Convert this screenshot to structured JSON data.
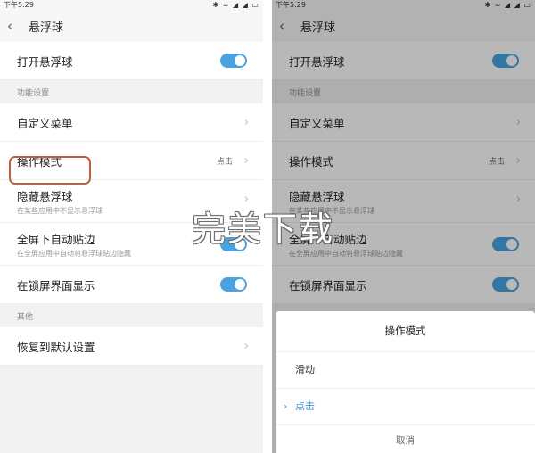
{
  "status_bar": {
    "time": "下午5:29",
    "icons": "✱ ≈ ◢ ◢ ▭"
  },
  "title": "悬浮球",
  "rows": {
    "open_float": "打开悬浮球",
    "section_function": "功能设置",
    "custom_menu": "自定义菜单",
    "operation_mode": "操作模式",
    "operation_mode_value": "点击",
    "hide_float": "隐藏悬浮球",
    "hide_float_sub": "在某些应用中不显示悬浮球",
    "fullscreen_stick": "全屏下自动贴边",
    "fullscreen_stick_sub": "在全屏应用中自动将悬浮球贴边隐藏",
    "lockscreen_show": "在锁屏界面显示",
    "section_other": "其他",
    "restore_default": "恢复到默认设置"
  },
  "dialog": {
    "title": "操作模式",
    "options": [
      "滑动",
      "点击"
    ],
    "selected": "点击",
    "cancel": "取消"
  },
  "watermark": "完美下载",
  "icons": {
    "back": "back-arrow-icon",
    "chevron": "chevron-right-icon",
    "check": "check-icon"
  },
  "colors": {
    "toggle_on": "#4aa3e0",
    "highlight": "#c0603a",
    "selected": "#3e96d6"
  }
}
